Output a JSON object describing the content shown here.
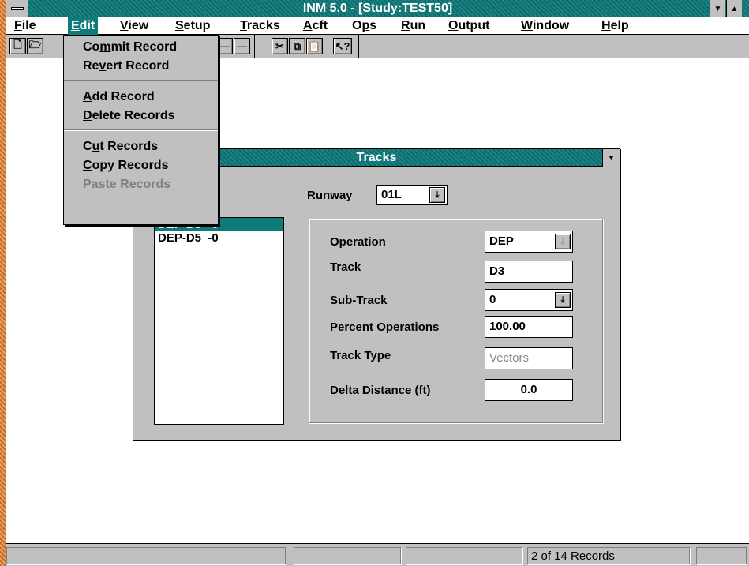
{
  "window": {
    "title": "INM 5.0 - [Study:TEST50]"
  },
  "menubar": [
    {
      "label": "File",
      "accel": "F",
      "rest": "ile"
    },
    {
      "label": "Edit",
      "accel": "E",
      "rest": "dit"
    },
    {
      "label": "View",
      "accel": "V",
      "rest": "iew"
    },
    {
      "label": "Setup",
      "accel": "S",
      "rest": "etup"
    },
    {
      "label": "Tracks",
      "accel": "T",
      "rest": "racks"
    },
    {
      "label": "Acft",
      "accel": "A",
      "rest": "cft"
    },
    {
      "label": "Ops",
      "pre": "O",
      "accel": "p",
      "rest": "s"
    },
    {
      "label": "Run",
      "accel": "R",
      "rest": "un"
    },
    {
      "label": "Output",
      "accel": "O",
      "rest": "utput"
    },
    {
      "label": "Window",
      "accel": "W",
      "rest": "indow"
    },
    {
      "label": "Help",
      "accel": "H",
      "rest": "elp"
    }
  ],
  "edit_menu": {
    "commit": {
      "pre": "Co",
      "accel": "m",
      "rest": "mit Record"
    },
    "revert": {
      "pre": "Re",
      "accel": "v",
      "rest": "ert Record"
    },
    "add": {
      "pre": "",
      "accel": "A",
      "rest": "dd Record"
    },
    "delete": {
      "pre": "",
      "accel": "D",
      "rest": "elete Records"
    },
    "cut": {
      "pre": "C",
      "accel": "u",
      "rest": "t Records"
    },
    "copy": {
      "pre": "",
      "accel": "C",
      "rest": "opy Records"
    },
    "paste": {
      "pre": "",
      "accel": "P",
      "rest": "aste Records"
    }
  },
  "toolbar": {
    "cut_glyph": "✂",
    "copy_glyph": "⧉",
    "paste_glyph": "📋",
    "help_glyph": "↖?",
    "dash_glyph": "—"
  },
  "tracks_window": {
    "title": "Tracks",
    "runway_label": "Runway",
    "runway_value": "01L",
    "list": [
      "DEP-D3  -0",
      "DEP-D5  -0"
    ],
    "fields": {
      "operation_label": "Operation",
      "operation_value": "DEP",
      "track_label": "Track",
      "track_value": "D3",
      "subtrack_label": "Sub-Track",
      "subtrack_value": "0",
      "percent_label": "Percent Operations",
      "percent_value": "100.00",
      "tracktype_label": "Track Type",
      "tracktype_value": "Vectors",
      "delta_label": "Delta Distance (ft)",
      "delta_value": "0.0"
    }
  },
  "statusbar": {
    "records": "2 of 14 Records"
  },
  "colors": {
    "accent": "#0f7a7a",
    "face": "#c0c0c0",
    "frame": "#c0803e"
  }
}
